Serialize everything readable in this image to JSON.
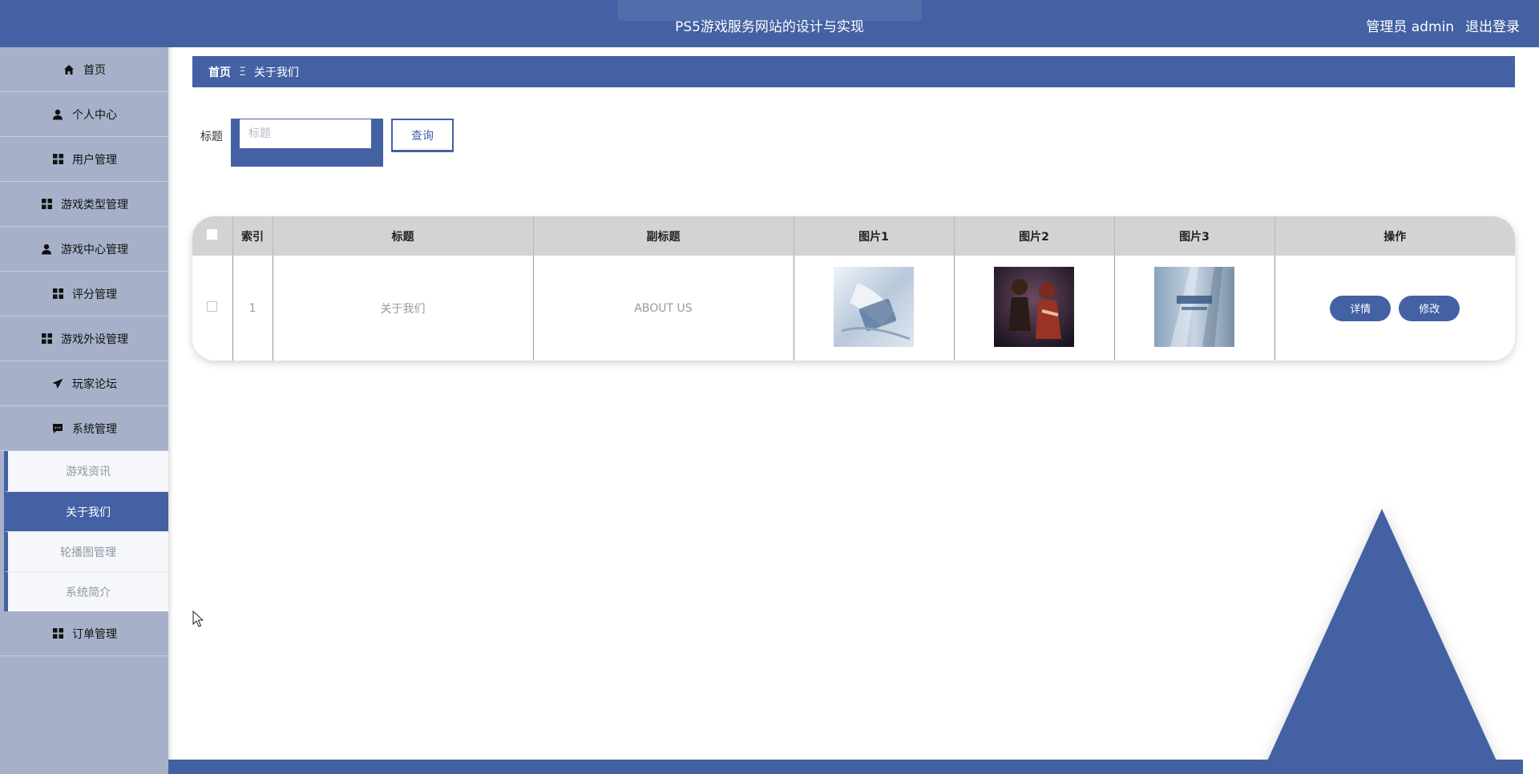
{
  "header": {
    "title": "PS5游戏服务网站的设计与实现",
    "user_label": "管理员 admin",
    "logout_label": "退出登录"
  },
  "sidebar": {
    "items": [
      {
        "label": "首页",
        "icon": "home-icon"
      },
      {
        "label": "个人中心",
        "icon": "person-icon"
      },
      {
        "label": "用户管理",
        "icon": "grid-icon"
      },
      {
        "label": "游戏类型管理",
        "icon": "grid-icon"
      },
      {
        "label": "游戏中心管理",
        "icon": "person-icon"
      },
      {
        "label": "评分管理",
        "icon": "grid-icon"
      },
      {
        "label": "游戏外设管理",
        "icon": "grid-icon"
      },
      {
        "label": "玩家论坛",
        "icon": "paper-plane-icon"
      },
      {
        "label": "系统管理",
        "icon": "chat-icon"
      }
    ],
    "submenu": [
      {
        "label": "游戏资讯"
      },
      {
        "label": "关于我们",
        "active": true
      },
      {
        "label": "轮播图管理"
      },
      {
        "label": "系统简介"
      }
    ],
    "after": {
      "label": "订单管理",
      "icon": "grid-icon"
    }
  },
  "breadcrumb": {
    "home": "首页",
    "separator": "Ξ",
    "current": "关于我们"
  },
  "search": {
    "label": "标题",
    "placeholder": "标题",
    "value": "",
    "button_label": "查询"
  },
  "table": {
    "columns": [
      "索引",
      "标题",
      "副标题",
      "图片1",
      "图片2",
      "图片3",
      "操作"
    ],
    "rows": [
      {
        "index": "1",
        "title": "关于我们",
        "subtitle": "ABOUT US"
      }
    ],
    "actions": {
      "detail": "详情",
      "edit": "修改"
    }
  },
  "colors": {
    "primary": "#4361a3",
    "sidebar_bg": "#a6b1c9",
    "table_header": "#d3d3d3"
  }
}
